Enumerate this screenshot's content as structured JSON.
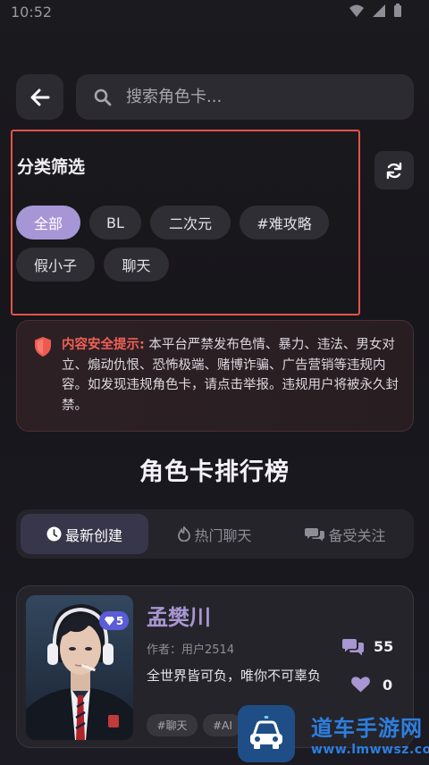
{
  "status_bar": {
    "time": "10:52"
  },
  "search": {
    "placeholder": "搜索角色卡..."
  },
  "filter": {
    "title": "分类筛选",
    "chips": [
      "全部",
      "BL",
      "二次元",
      "#难攻略",
      "假小子",
      "聊天"
    ],
    "active_index": 0
  },
  "notice": {
    "label": "内容安全提示:",
    "text": "本平台严禁发布色情、暴力、违法、男女对立、煽动仇恨、恐怖极端、赌博诈骗、广告营销等违规内容。如发现违规角色卡，请点击举报。违规用户将被永久封禁。"
  },
  "ranking": {
    "title": "角色卡排行榜",
    "tabs": [
      "最新创建",
      "热门聊天",
      "备受关注"
    ],
    "active_tab": 0
  },
  "cards": [
    {
      "name": "孟樊川",
      "author": "作者：用户2514",
      "description": "全世界皆可负，唯你不可辜负",
      "badge": "5",
      "tags": [
        "#聊天",
        "#AI"
      ],
      "chats": "55",
      "likes": "0"
    }
  ],
  "watermark": {
    "line1": "道车手游网",
    "line2": "www.lmwwsz.com"
  },
  "colors": {
    "accent": "#a796d6",
    "warning": "#ef6056",
    "highlight_border": "#e4524a"
  }
}
